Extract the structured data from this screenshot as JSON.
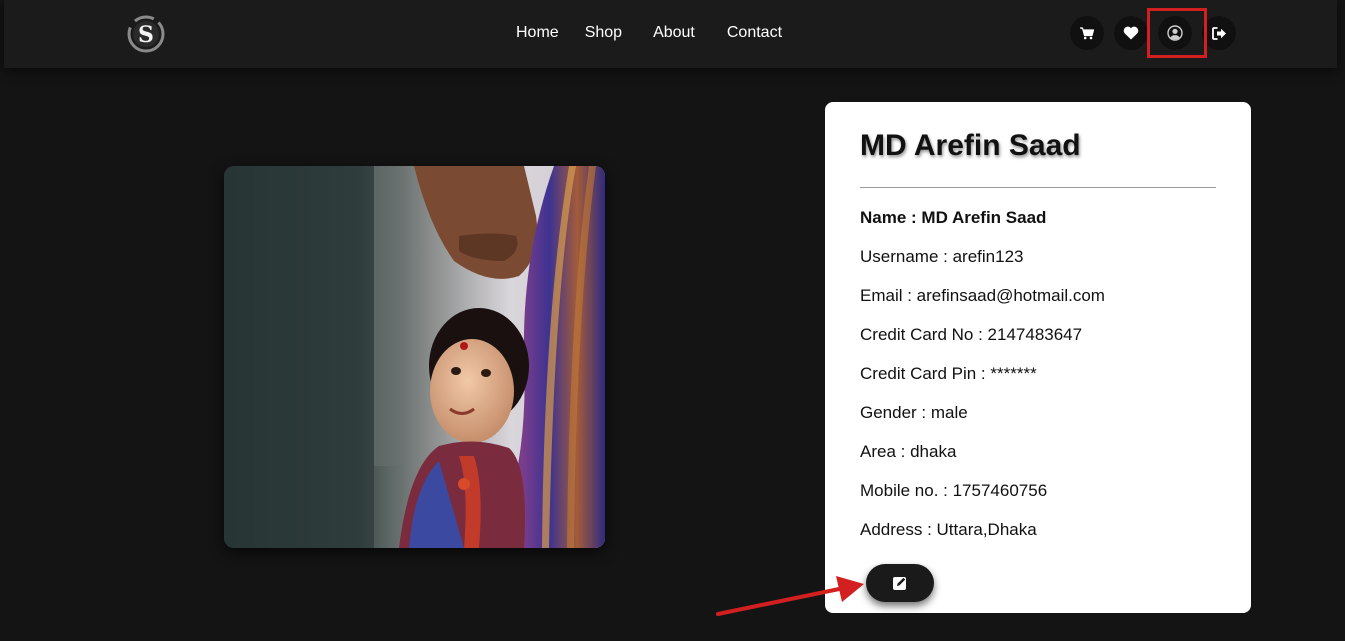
{
  "nav": {
    "logo_letter": "S",
    "links": [
      "Home",
      "Shop",
      "About",
      "Contact"
    ],
    "icons": [
      "cart-icon",
      "heart-icon",
      "user-circle-icon",
      "logout-icon"
    ]
  },
  "profile": {
    "title": "MD Arefin Saad",
    "details": [
      "Name : MD Arefin Saad",
      "Username : arefin123",
      "Email : arefinsaad@hotmail.com",
      "Credit Card No : 2147483647",
      "Credit Card Pin : *******",
      "Gender : male",
      "Area : dhaka",
      "Mobile no. : 1757460756",
      "Address : Uttara,Dhaka"
    ],
    "edit_icon": "edit-icon"
  },
  "colors": {
    "background": "#141414",
    "navbar": "#1b1b1b",
    "card": "#ffffff",
    "annotation": "#d21f1f"
  }
}
